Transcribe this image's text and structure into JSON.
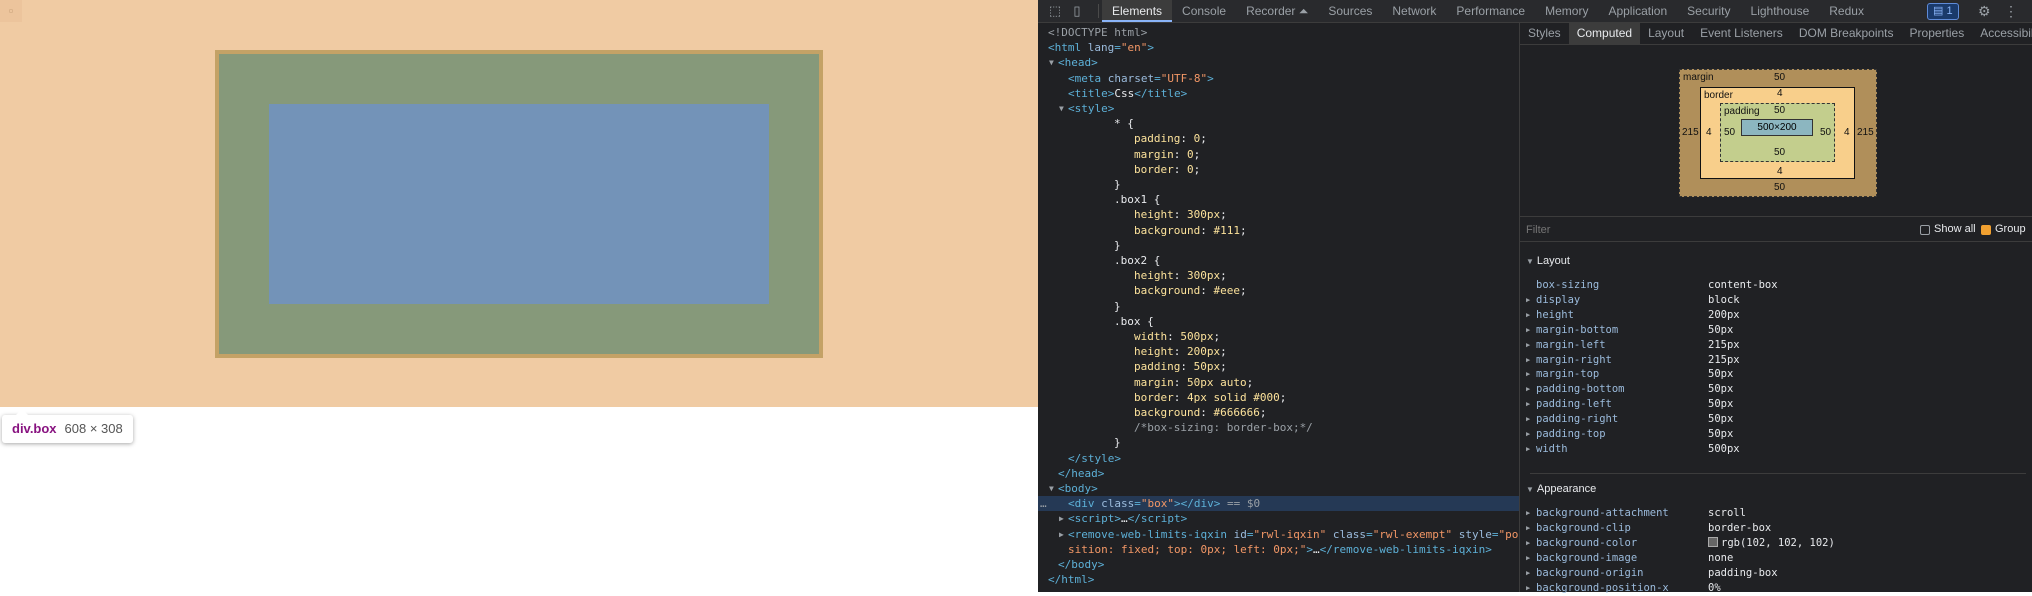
{
  "preview": {
    "tooltip_element": "div.box",
    "tooltip_size": "608 × 308"
  },
  "devtools": {
    "tabs": [
      "Elements",
      "Console",
      "Recorder ⏶",
      "Sources",
      "Network",
      "Performance",
      "Memory",
      "Application",
      "Security",
      "Lighthouse",
      "Redux"
    ],
    "active_tab": "Elements",
    "issues_count": "1",
    "elements_tree": {
      "doctype": "<!DOCTYPE html>",
      "html_open": "html",
      "html_lang_attr": "lang",
      "html_lang_val": "\"en\"",
      "head": "head",
      "meta_tag": "meta",
      "meta_attr": "charset",
      "meta_val": "\"UTF-8\"",
      "title_tag": "title",
      "title_text": "Css",
      "style_tag": "style",
      "css_lines": [
        {
          "indent": 2,
          "sel": "* {"
        },
        {
          "indent": 3,
          "prop": "padding",
          "val": "0"
        },
        {
          "indent": 3,
          "prop": "margin",
          "val": "0"
        },
        {
          "indent": 3,
          "prop": "border",
          "val": "0"
        },
        {
          "indent": 2,
          "sel": "}"
        },
        {
          "indent": 2,
          "sel": ".box1 {"
        },
        {
          "indent": 3,
          "prop": "height",
          "val": "300px"
        },
        {
          "indent": 3,
          "prop": "background",
          "val": "#111"
        },
        {
          "indent": 2,
          "sel": "}"
        },
        {
          "indent": 2,
          "sel": ".box2 {"
        },
        {
          "indent": 3,
          "prop": "height",
          "val": "300px"
        },
        {
          "indent": 3,
          "prop": "background",
          "val": "#eee"
        },
        {
          "indent": 2,
          "sel": "}"
        },
        {
          "indent": 2,
          "sel": ".box {"
        },
        {
          "indent": 3,
          "prop": "width",
          "val": "500px"
        },
        {
          "indent": 3,
          "prop": "height",
          "val": "200px"
        },
        {
          "indent": 3,
          "prop": "padding",
          "val": "50px"
        },
        {
          "indent": 3,
          "prop": "margin",
          "val": "50px auto"
        },
        {
          "indent": 3,
          "prop": "border",
          "val": "4px solid #000"
        },
        {
          "indent": 3,
          "prop": "background",
          "val": "#666666"
        },
        {
          "indent": 3,
          "comment": "/*box-sizing: border-box;*/"
        },
        {
          "indent": 2,
          "sel": "}"
        }
      ],
      "style_close": "</style>",
      "head_close": "</head>",
      "body": "body",
      "selected_div": "div",
      "selected_class_attr": "class",
      "selected_class_val": "\"box\"",
      "selected_suffix": " == $0",
      "script_tag": "script",
      "script_ellipsis": "…",
      "remove_tag": "remove-web-limits-iqxin",
      "remove_id_attr": "id",
      "remove_id_val": "\"rwl-iqxin\"",
      "remove_class_attr": "class",
      "remove_class_val": "\"rwl-exempt\"",
      "remove_style_attr": "style",
      "remove_style_val_1": "\"po",
      "remove_style_val_2": "sition: fixed; top: 0px; left: 0px;\"",
      "body_close": "</body>",
      "html_close": "</html>"
    },
    "sidebar_tabs": [
      "Styles",
      "Computed",
      "Layout",
      "Event Listeners",
      "DOM Breakpoints",
      "Properties",
      "Accessibility"
    ],
    "active_sidebar_tab": "Computed",
    "box_model": {
      "margin_label": "margin",
      "margin_top": "50",
      "margin_bottom": "50",
      "margin_left": "215",
      "margin_right": "215",
      "border_label": "border",
      "border_top": "4",
      "border_bottom": "4",
      "border_left": "4",
      "border_right": "4",
      "padding_label": "padding",
      "padding_top": "50",
      "padding_bottom": "50",
      "padding_left": "50",
      "padding_right": "50",
      "content": "500×200"
    },
    "filter": {
      "placeholder": "Filter",
      "show_all": "Show all",
      "group": "Group",
      "group_checked": true
    },
    "layout_section": {
      "title": "Layout",
      "props": [
        {
          "name": "box-sizing",
          "value": "content-box",
          "expandable": false
        },
        {
          "name": "display",
          "value": "block",
          "expandable": true
        },
        {
          "name": "height",
          "value": "200px",
          "expandable": true
        },
        {
          "name": "margin-bottom",
          "value": "50px",
          "expandable": true
        },
        {
          "name": "margin-left",
          "value": "215px",
          "expandable": true
        },
        {
          "name": "margin-right",
          "value": "215px",
          "expandable": true
        },
        {
          "name": "margin-top",
          "value": "50px",
          "expandable": true
        },
        {
          "name": "padding-bottom",
          "value": "50px",
          "expandable": true
        },
        {
          "name": "padding-left",
          "value": "50px",
          "expandable": true
        },
        {
          "name": "padding-right",
          "value": "50px",
          "expandable": true
        },
        {
          "name": "padding-top",
          "value": "50px",
          "expandable": true
        },
        {
          "name": "width",
          "value": "500px",
          "expandable": true
        }
      ]
    },
    "appearance_section": {
      "title": "Appearance",
      "props": [
        {
          "name": "background-attachment",
          "value": "scroll",
          "expandable": true
        },
        {
          "name": "background-clip",
          "value": "border-box",
          "expandable": true
        },
        {
          "name": "background-color",
          "value": "rgb(102, 102, 102)",
          "expandable": true,
          "swatch": "#666666"
        },
        {
          "name": "background-image",
          "value": "none",
          "expandable": true
        },
        {
          "name": "background-origin",
          "value": "padding-box",
          "expandable": true
        },
        {
          "name": "background-position-x",
          "value": "0%",
          "expandable": true
        }
      ]
    }
  },
  "colors": {
    "margin_highlight": "#f0cba3",
    "border_highlight": "#c4a266",
    "padding_highlight": "#86997a",
    "content_highlight": "#7393b8",
    "devtools_bg": "#202124",
    "selected_row": "#253955"
  }
}
